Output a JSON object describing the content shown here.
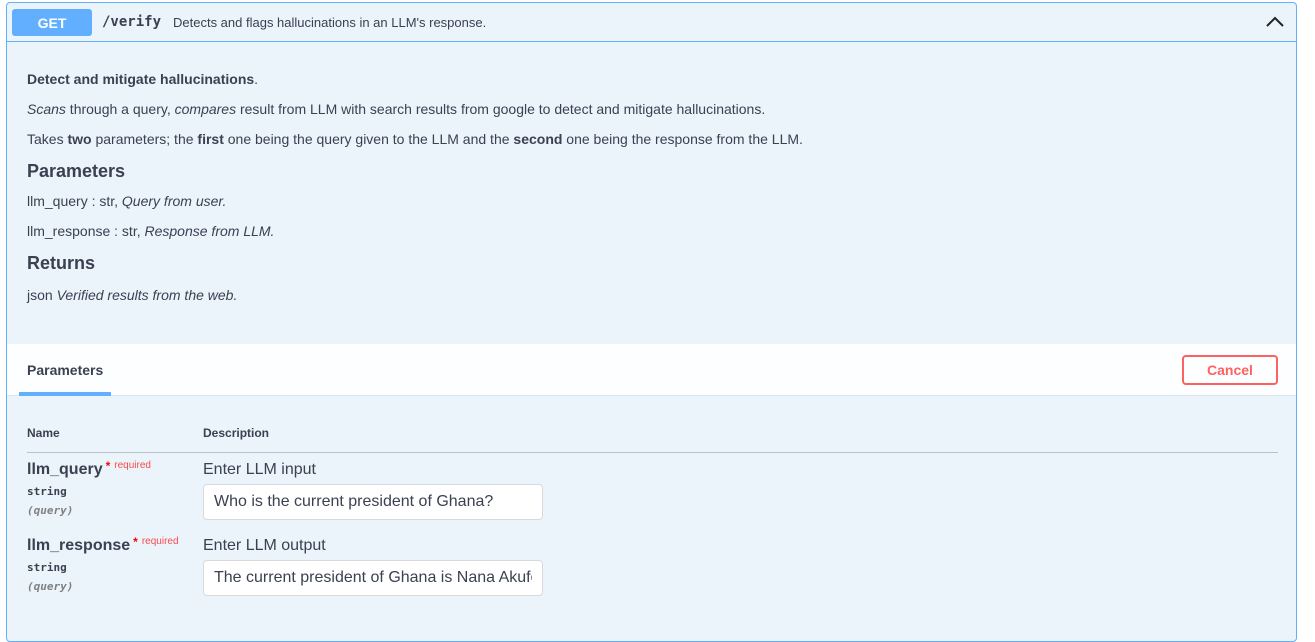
{
  "summary": {
    "method": "GET",
    "path": "/verify",
    "description": "Detects and flags hallucinations in an LLM's response.",
    "collapse_icon": "chevron-up-icon"
  },
  "description": {
    "heading_bold": "Detect and mitigate hallucinations",
    "heading_tail": ".",
    "line2_em1": "Scans",
    "line2_mid": " through a query, ",
    "line2_em2": "compares",
    "line2_tail": " result from LLM with search results from google to detect and mitigate hallucinations.",
    "line3_a": "Takes ",
    "line3_b": "two",
    "line3_c": " parameters; the ",
    "line3_d": "first",
    "line3_e": " one being the query given to the LLM and the ",
    "line3_f": "second",
    "line3_g": " one being the response from the LLM.",
    "parameters_heading": "Parameters",
    "p1_name": "llm_query : str, ",
    "p1_desc": "Query from user.",
    "p2_name": "llm_response : str, ",
    "p2_desc": "Response from LLM.",
    "returns_heading": "Returns",
    "ret_type": "json ",
    "ret_desc": "Verified results from the web."
  },
  "params_section": {
    "tab_label": "Parameters",
    "cancel_label": "Cancel",
    "col_name": "Name",
    "col_description": "Description"
  },
  "params": [
    {
      "name": "llm_query",
      "required_star": "*",
      "required_label": "required",
      "type": "string",
      "in": "(query)",
      "description": "Enter LLM input",
      "value": "Who is the current president of Ghana?"
    },
    {
      "name": "llm_response",
      "required_star": "*",
      "required_label": "required",
      "type": "string",
      "in": "(query)",
      "description": "Enter LLM output",
      "value": "The current president of Ghana is Nana Akufo-Addo."
    }
  ],
  "colors": {
    "get_blue": "#61affe",
    "block_bg": "#ebf3fb",
    "cancel_red": "#ff6060",
    "required_red": "#ff0000"
  }
}
